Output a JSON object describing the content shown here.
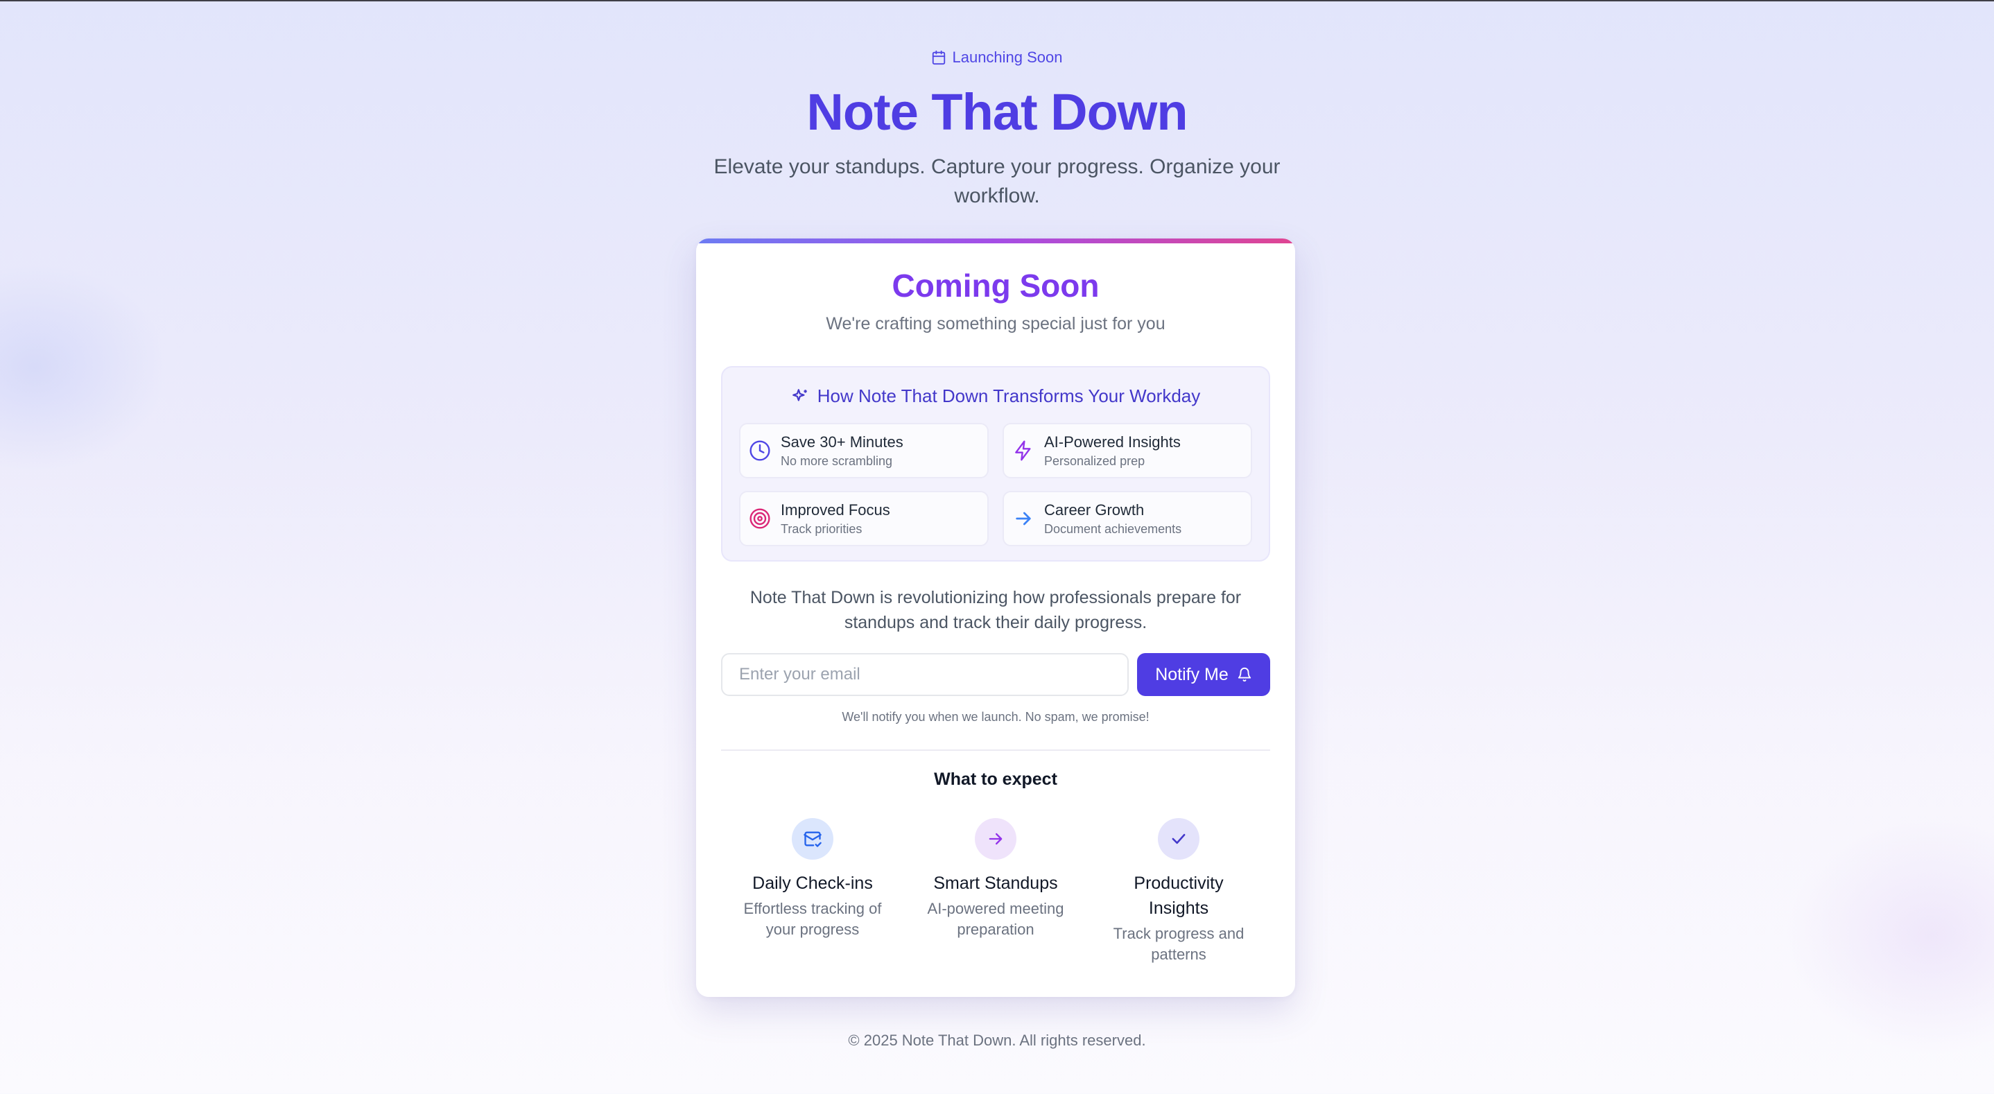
{
  "hero": {
    "badge_icon": "calendar-icon",
    "badge": "Launching Soon",
    "title": "Note That Down",
    "subtitle": "Elevate your standups. Capture your progress. Organize your workflow."
  },
  "card": {
    "heading": "Coming Soon",
    "tagline": "We're crafting something special just for you",
    "transform": {
      "icon": "sparkles-icon",
      "title": "How Note That Down Transforms Your Workday",
      "features": [
        {
          "icon": "clock-icon",
          "title": "Save 30+ Minutes",
          "subtitle": "No more scrambling",
          "color": "#4f46e5"
        },
        {
          "icon": "zap-icon",
          "title": "AI-Powered Insights",
          "subtitle": "Personalized prep",
          "color": "#9333ea"
        },
        {
          "icon": "target-icon",
          "title": "Improved Focus",
          "subtitle": "Track priorities",
          "color": "#db2777"
        },
        {
          "icon": "arrow-right-icon",
          "title": "Career Growth",
          "subtitle": "Document achievements",
          "color": "#3b82f6"
        }
      ]
    },
    "description": "Note That Down is revolutionizing how professionals prepare for standups and track their daily progress.",
    "form": {
      "email_placeholder": "Enter your email",
      "email_value": "",
      "button_label": "Notify Me",
      "button_icon": "bell-icon"
    },
    "no_spam": "We'll notify you when we launch. No spam, we promise!",
    "expect_title": "What to expect",
    "expect": [
      {
        "icon": "mail-check-icon",
        "title": "Daily Check-ins",
        "subtitle": "Effortless tracking of your progress"
      },
      {
        "icon": "arrow-right-icon",
        "title": "Smart Standups",
        "subtitle": "AI-powered meeting preparation"
      },
      {
        "icon": "check-icon",
        "title": "Productivity Insights",
        "subtitle": "Track progress and patterns"
      }
    ]
  },
  "footer": "© 2025 Note That Down. All rights reserved.",
  "colors": {
    "brand": "#4f3de3",
    "heading_purple": "#7c3aed",
    "card_bar": [
      "#6d7cf3",
      "#a54ee6",
      "#e04592"
    ]
  }
}
